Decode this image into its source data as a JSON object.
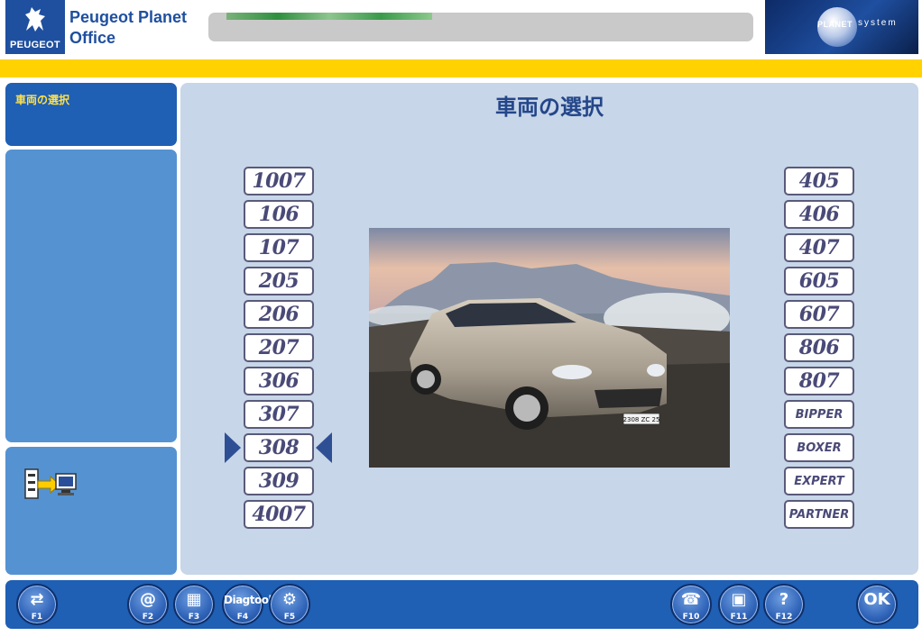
{
  "header": {
    "logo_text": "PEUGEOT",
    "title_line1": "Peugeot Planet",
    "title_line2": "Office",
    "planet_word": "PLANET",
    "system_word": "system"
  },
  "sidebar": {
    "title": "車両の選択"
  },
  "main": {
    "title": "車両の選択",
    "left_models": [
      "1007",
      "106",
      "107",
      "205",
      "206",
      "207",
      "306",
      "307",
      "308",
      "309",
      "4007"
    ],
    "right_models": [
      "405",
      "406",
      "407",
      "605",
      "607",
      "806",
      "807",
      "BIPPER",
      "BOXER",
      "EXPERT",
      "PARTNER"
    ],
    "selected_model": "308",
    "photo_plate": "2308 ZC 25"
  },
  "footer": {
    "keys": [
      {
        "label": "F1",
        "glyph": "⇄",
        "icon": "exit-icon"
      },
      {
        "label": "F2",
        "glyph": "@",
        "icon": "at-icon"
      },
      {
        "label": "F3",
        "glyph": "▦",
        "icon": "chart-icon"
      },
      {
        "label": "F4",
        "glyph": "Diagtool",
        "icon": "diagtool-icon"
      },
      {
        "label": "F5",
        "glyph": "⚙",
        "icon": "tools-icon"
      },
      {
        "label": "F10",
        "glyph": "☎",
        "icon": "phone-icon"
      },
      {
        "label": "F11",
        "glyph": "▣",
        "icon": "language-icon"
      },
      {
        "label": "F12",
        "glyph": "?",
        "icon": "help-icon"
      },
      {
        "label": "",
        "glyph": "OK",
        "icon": "ok-icon"
      }
    ]
  },
  "colors": {
    "brand_blue": "#1f5fb4",
    "accent_yellow": "#ffd200",
    "panel_light": "#c7d6e8",
    "model_text": "#4a4a78"
  }
}
